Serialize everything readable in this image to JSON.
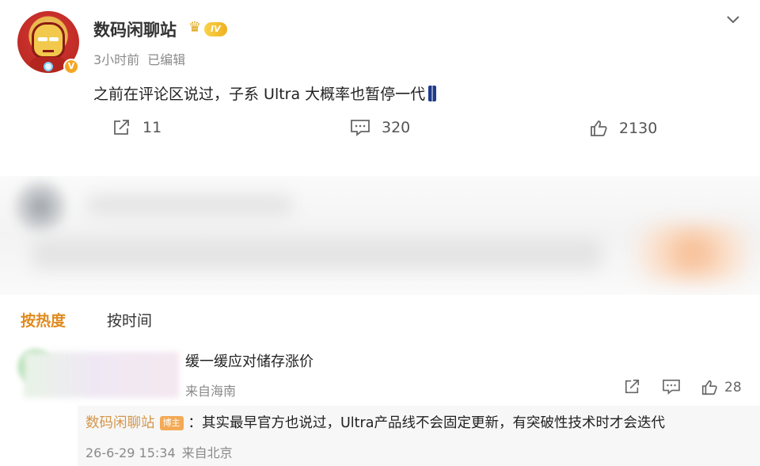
{
  "post": {
    "author": "数码闲聊站",
    "level": "IV",
    "verified_mark": "V",
    "time": "3小时前",
    "edited": "已编辑",
    "text": "之前在评论区说过，子系 Ultra 大概率也暂停一代",
    "actions": {
      "share_count": "11",
      "comment_count": "320",
      "like_count": "2130"
    }
  },
  "sort_tabs": {
    "hot": "按热度",
    "time": "按时间"
  },
  "comment": {
    "text": "缓一缓应对储存涨价",
    "location": "来自海南",
    "like_count": "28",
    "reply": {
      "author": "数码闲聊站",
      "badge": "博主",
      "text": "：其实最早官方也说过，Ultra产品线不会固定更新，有突破性技术时才会迭代",
      "time": "26-6-29 15:34",
      "location": "来自北京"
    }
  },
  "colors": {
    "accent": "#e08a1e",
    "reply_name": "#d4964a",
    "owner_badge": "#f3a955",
    "muted_text": "#8a8a8a"
  },
  "icons": [
    "share-icon",
    "comment-icon",
    "like-icon",
    "chevron-down-icon",
    "crown-icon"
  ]
}
